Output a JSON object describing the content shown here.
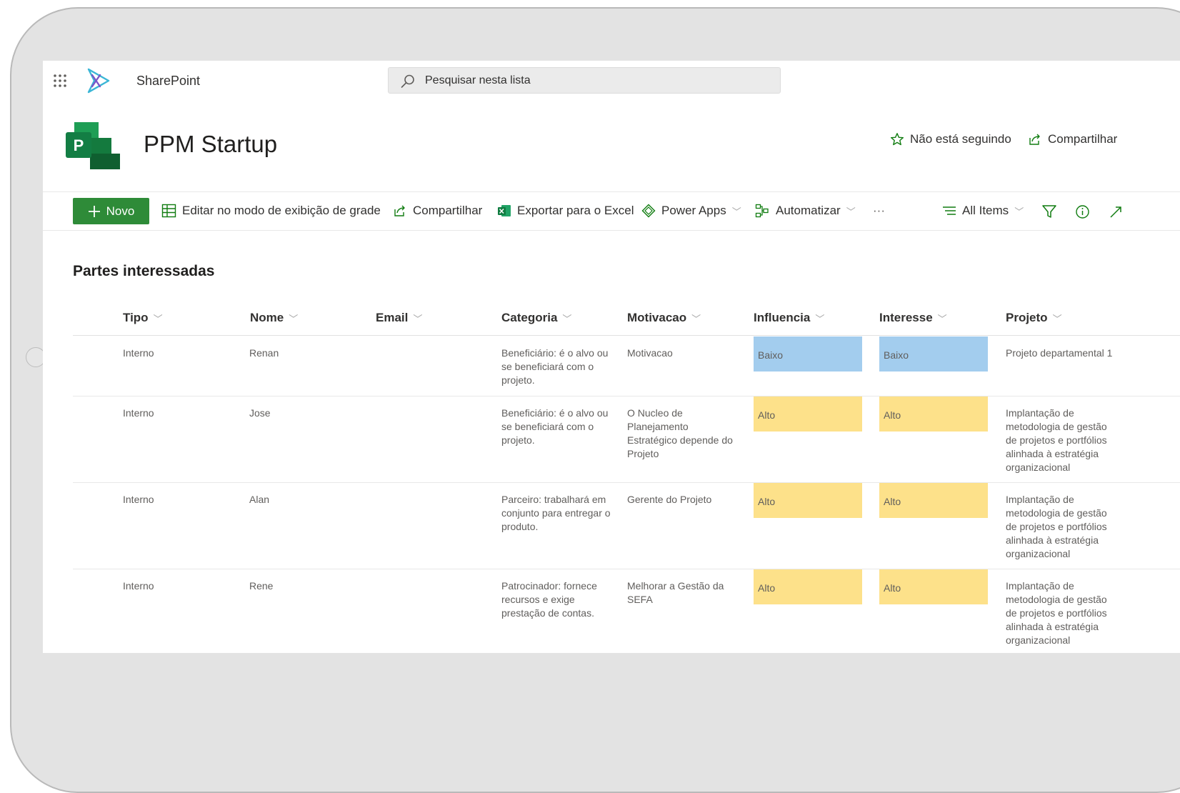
{
  "suite_bar": {
    "app_name": "SharePoint",
    "search_placeholder": "Pesquisar nesta lista"
  },
  "site": {
    "title": "PPM Startup",
    "follow_label": "Não está seguindo",
    "share_label": "Compartilhar"
  },
  "command_bar": {
    "new_label": "Novo",
    "grid_edit_label": "Editar no modo de exibição de grade",
    "share_label": "Compartilhar",
    "export_label": "Exportar para o Excel",
    "power_apps_label": "Power Apps",
    "automate_label": "Automatizar",
    "more_label": "···",
    "view_label": "All Items"
  },
  "list": {
    "title": "Partes interessadas",
    "columns": [
      "Tipo",
      "Nome",
      "Email",
      "Categoria",
      "Motivacao",
      "Influencia",
      "Interesse",
      "Projeto"
    ],
    "rows": [
      {
        "tipo": "Interno",
        "nome": "Renan",
        "email": "",
        "categoria": "Beneficiário: é o alvo ou se beneficiará com o projeto.",
        "motivacao": "Motivacao",
        "influencia": "Baixo",
        "interesse": "Baixo",
        "projeto": "Projeto departamental 1"
      },
      {
        "tipo": "Interno",
        "nome": "Jose",
        "email": "",
        "categoria": "Beneficiário: é o alvo ou se beneficiará com o projeto.",
        "motivacao": "O Nucleo de Planejamento Estratégico depende do Projeto",
        "influencia": "Alto",
        "interesse": "Alto",
        "projeto": "Implantação de metodologia de gestão de projetos e portfólios alinhada à estratégia organizacional"
      },
      {
        "tipo": "Interno",
        "nome": "Alan",
        "email": "",
        "categoria": "Parceiro: trabalhará em conjunto para entregar o produto.",
        "motivacao": "Gerente do Projeto",
        "influencia": "Alto",
        "interesse": "Alto",
        "projeto": "Implantação de metodologia de gestão de projetos e portfólios alinhada à estratégia organizacional"
      },
      {
        "tipo": "Interno",
        "nome": "Rene",
        "email": "",
        "categoria": "Patrocinador: fornece recursos e exige prestação de contas.",
        "motivacao": "Melhorar a Gestão da SEFA",
        "influencia": "Alto",
        "interesse": "Alto",
        "projeto": "Implantação de metodologia de gestão de projetos e portfólios alinhada à estratégia organizacional"
      }
    ]
  },
  "colors": {
    "new_button": "#2e8b38",
    "baixo": "#a3cdee",
    "alto": "#fde18a"
  }
}
